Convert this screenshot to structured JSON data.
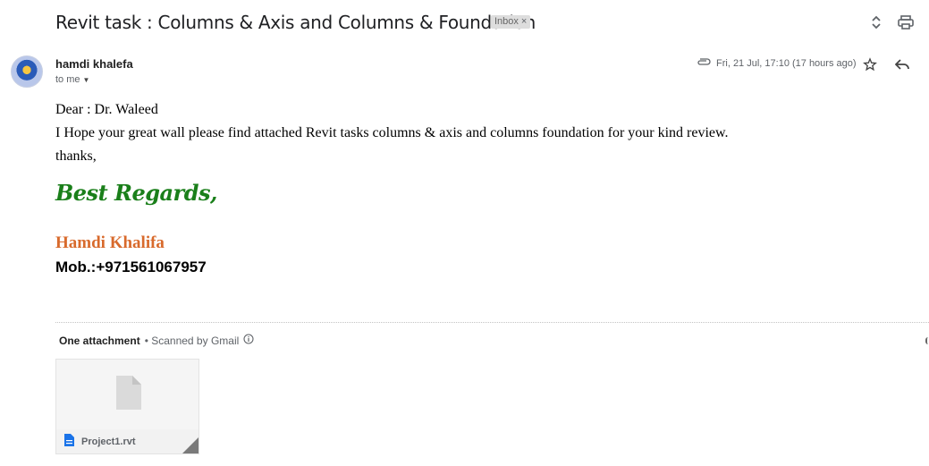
{
  "email": {
    "subject": "Revit task : Columns & Axis and Columns & Foundation",
    "label": "Inbox",
    "label_close": "×",
    "sender_name": "hamdi khalefa",
    "recipient": "to me",
    "date": "Fri, 21 Jul, 17:10 (17 hours ago)",
    "body_lines": [
      "Dear : Dr. Waleed",
      "I Hope your great wall please find attached Revit tasks columns & axis and columns foundation for your kind review.",
      "thanks,"
    ],
    "signature": {
      "regards": "Best Regards,",
      "name": "Hamdi Khalifa",
      "mobile": "Mob.:+971561067957"
    }
  },
  "attachments": {
    "count_label": "One attachment",
    "scan_label": "• Scanned by Gmail",
    "items": [
      {
        "filename": "Project1.rvt"
      }
    ]
  },
  "colors": {
    "signature_green": "#1a7f1a",
    "signature_orange": "#d86a2c",
    "file_icon_blue": "#1a73e8",
    "chip_bg": "#dddddd"
  },
  "icons": [
    "expand-collapse-icon",
    "print-icon",
    "attachment-clip-icon",
    "star-icon",
    "reply-icon",
    "info-icon",
    "file-icon",
    "document-icon"
  ]
}
